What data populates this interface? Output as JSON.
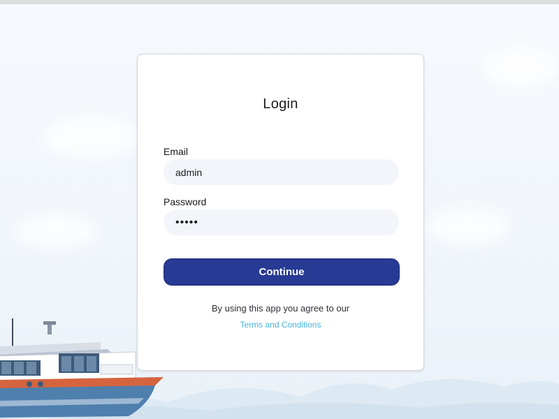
{
  "login": {
    "title": "Login",
    "email_label": "Email",
    "email_value": "admin",
    "password_label": "Password",
    "password_value": "•••••",
    "continue_label": "Continue",
    "agreement_text": "By using this app you agree to our",
    "terms_link": "Terms and Conditions"
  },
  "colors": {
    "button_bg": "#273a94",
    "link": "#4ab4de",
    "input_bg": "#f4f5fa",
    "page_bg": "#eef4fb"
  },
  "icons": {
    "background_illustration": "boat-illustration"
  }
}
